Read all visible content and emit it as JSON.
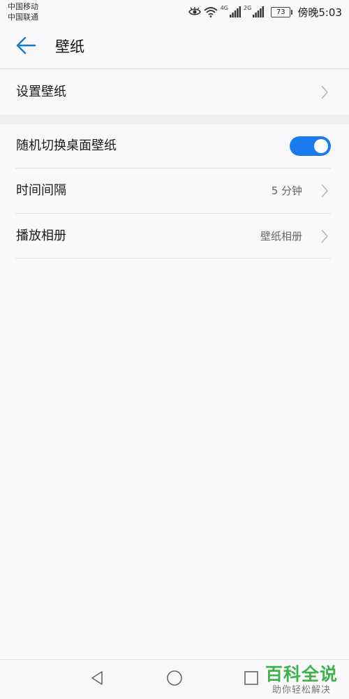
{
  "status_bar": {
    "carrier_1": "中国移动",
    "carrier_2": "中国联通",
    "net_1": "4G",
    "net_2": "2G",
    "battery": "73",
    "time": "傍晚5:03",
    "icons": [
      "eye-comfort-icon",
      "wifi-icon",
      "signal-icon",
      "signal-icon",
      "battery-icon"
    ]
  },
  "header": {
    "title": "壁纸",
    "back_icon": "back-arrow-icon"
  },
  "settings": {
    "set_wallpaper": {
      "label": "设置壁纸"
    },
    "random_switch": {
      "label": "随机切换桌面壁纸",
      "enabled": true
    },
    "interval": {
      "label": "时间间隔",
      "value": "5 分钟"
    },
    "album": {
      "label": "播放相册",
      "value": "壁纸相册"
    }
  },
  "nav_bar": {
    "buttons": [
      "back-triangle-icon",
      "home-circle-icon",
      "recents-square-icon"
    ]
  },
  "watermark": {
    "title": "百科全说",
    "subtitle": "助你轻松解决"
  },
  "colors": {
    "accent": "#1a7af0",
    "background": "#f8f8fa",
    "watermark_green": "#3db24a"
  }
}
